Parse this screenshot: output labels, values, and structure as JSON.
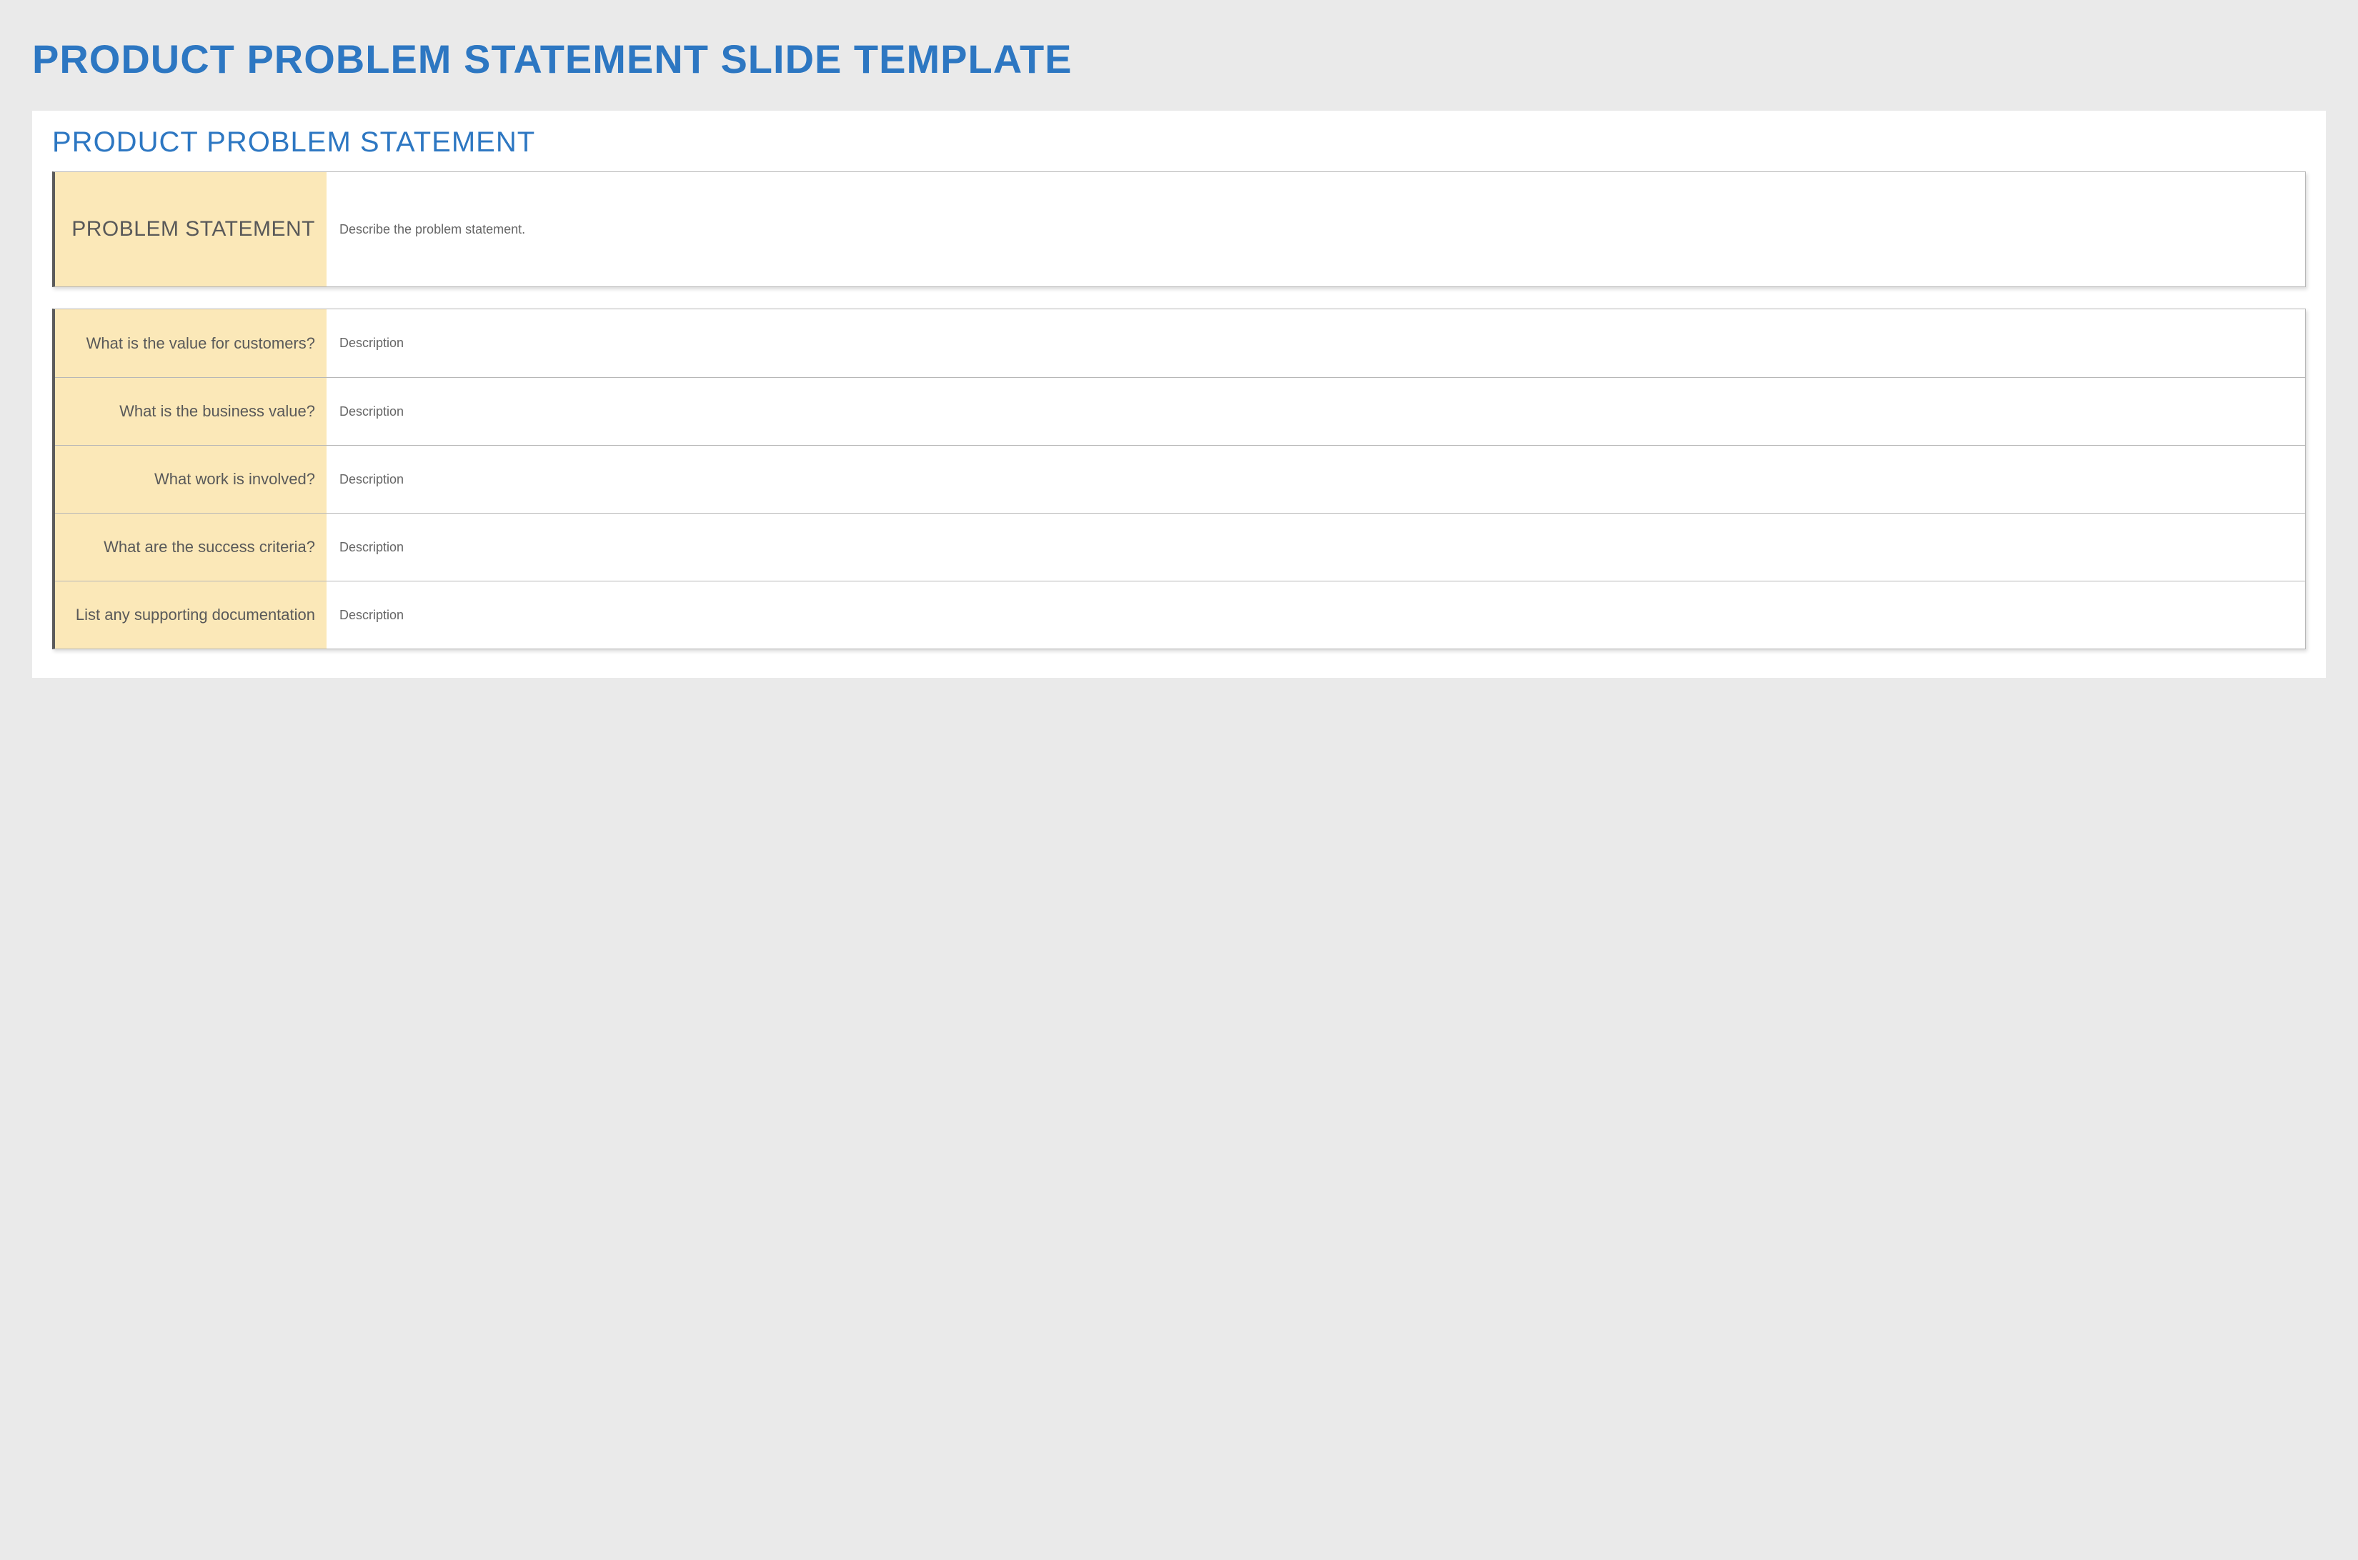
{
  "page_title": "PRODUCT PROBLEM STATEMENT SLIDE TEMPLATE",
  "slide_title": "PRODUCT PROBLEM STATEMENT",
  "main": {
    "label": "PROBLEM STATEMENT",
    "value": "Describe the problem statement."
  },
  "details": [
    {
      "label": "What is the value for customers?",
      "value": "Description"
    },
    {
      "label": "What is the business value?",
      "value": "Description"
    },
    {
      "label": "What work is involved?",
      "value": "Description"
    },
    {
      "label": "What are the success criteria?",
      "value": "Description"
    },
    {
      "label": "List any supporting documentation",
      "value": "Description"
    }
  ]
}
